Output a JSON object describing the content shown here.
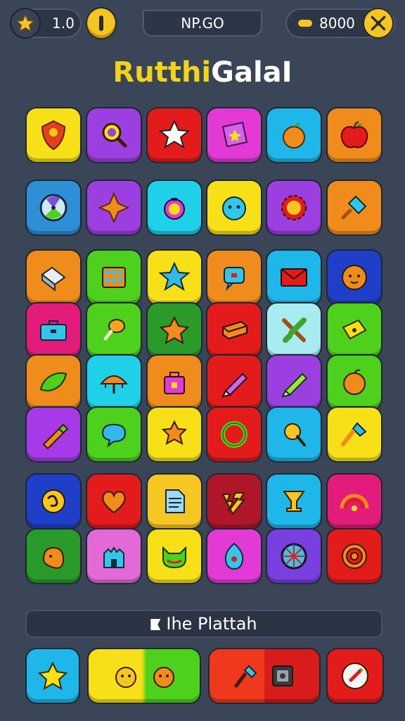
{
  "hud": {
    "stars_value": "1.0",
    "level_label": "NP.GO",
    "coins_value": "8000",
    "star_icon": "star-icon",
    "coin_icon": "coin-icon",
    "tools_icon": "tools-icon"
  },
  "title": {
    "part_a": "Rutthi",
    "part_b": "GalaI"
  },
  "banner": {
    "label": "Ihe Plattah",
    "icon": "banner-flag-icon"
  },
  "colors": {
    "background": "#3a4658",
    "yellow": "#f7e017",
    "purple": "#9b3fe0",
    "red": "#e31b1b",
    "pink": "#e33ad6",
    "cyan": "#1fb6e9",
    "orange": "#f08c1c",
    "green": "#4ed11c"
  },
  "board": {
    "row1": [
      "shield-crest-icon",
      "magnifier-icon",
      "star-icon",
      "star-sticker-icon",
      "orange-fruit-icon",
      "apple-icon"
    ],
    "row2": [
      "compass-dial-icon",
      "origami-star-icon",
      "pocket-watch-icon",
      "blob-face-icon",
      "gear-face-icon",
      "popsicle-icon"
    ],
    "row3": [
      "eraser-icon",
      "calendar-grid-icon",
      "star-icon",
      "speech-bubble-icon",
      "envelope-icon",
      "smiley-ball-icon"
    ],
    "row4": [
      "toolbox-icon",
      "drumstick-icon",
      "star-badge-icon",
      "brick-icon",
      "crossed-sticks-icon",
      "ticket-icon"
    ],
    "row5": [
      "leaf-icon",
      "umbrella-icon",
      "lock-bag-icon",
      "pencil-icon",
      "crayon-icon",
      "orange-ball-icon"
    ],
    "row6": [
      "crayon-stick-icon",
      "speech-bubble-icon",
      "puzzle-star-icon",
      "ring-icon",
      "racket-icon",
      "torch-icon"
    ],
    "row7": [
      "knot-icon",
      "heart-icon",
      "document-icon",
      "lightning-icon",
      "goblet-icon",
      "rainbow-icon"
    ],
    "row8": [
      "hand-pouch-icon",
      "castle-icon",
      "cat-leaf-icon",
      "shield-drop-icon",
      "wheel-icon",
      "target-icon"
    ]
  },
  "bottom_bar": [
    "star-button-icon",
    "face-pair-icon",
    "tools-pair-icon",
    "rocket-icon"
  ]
}
